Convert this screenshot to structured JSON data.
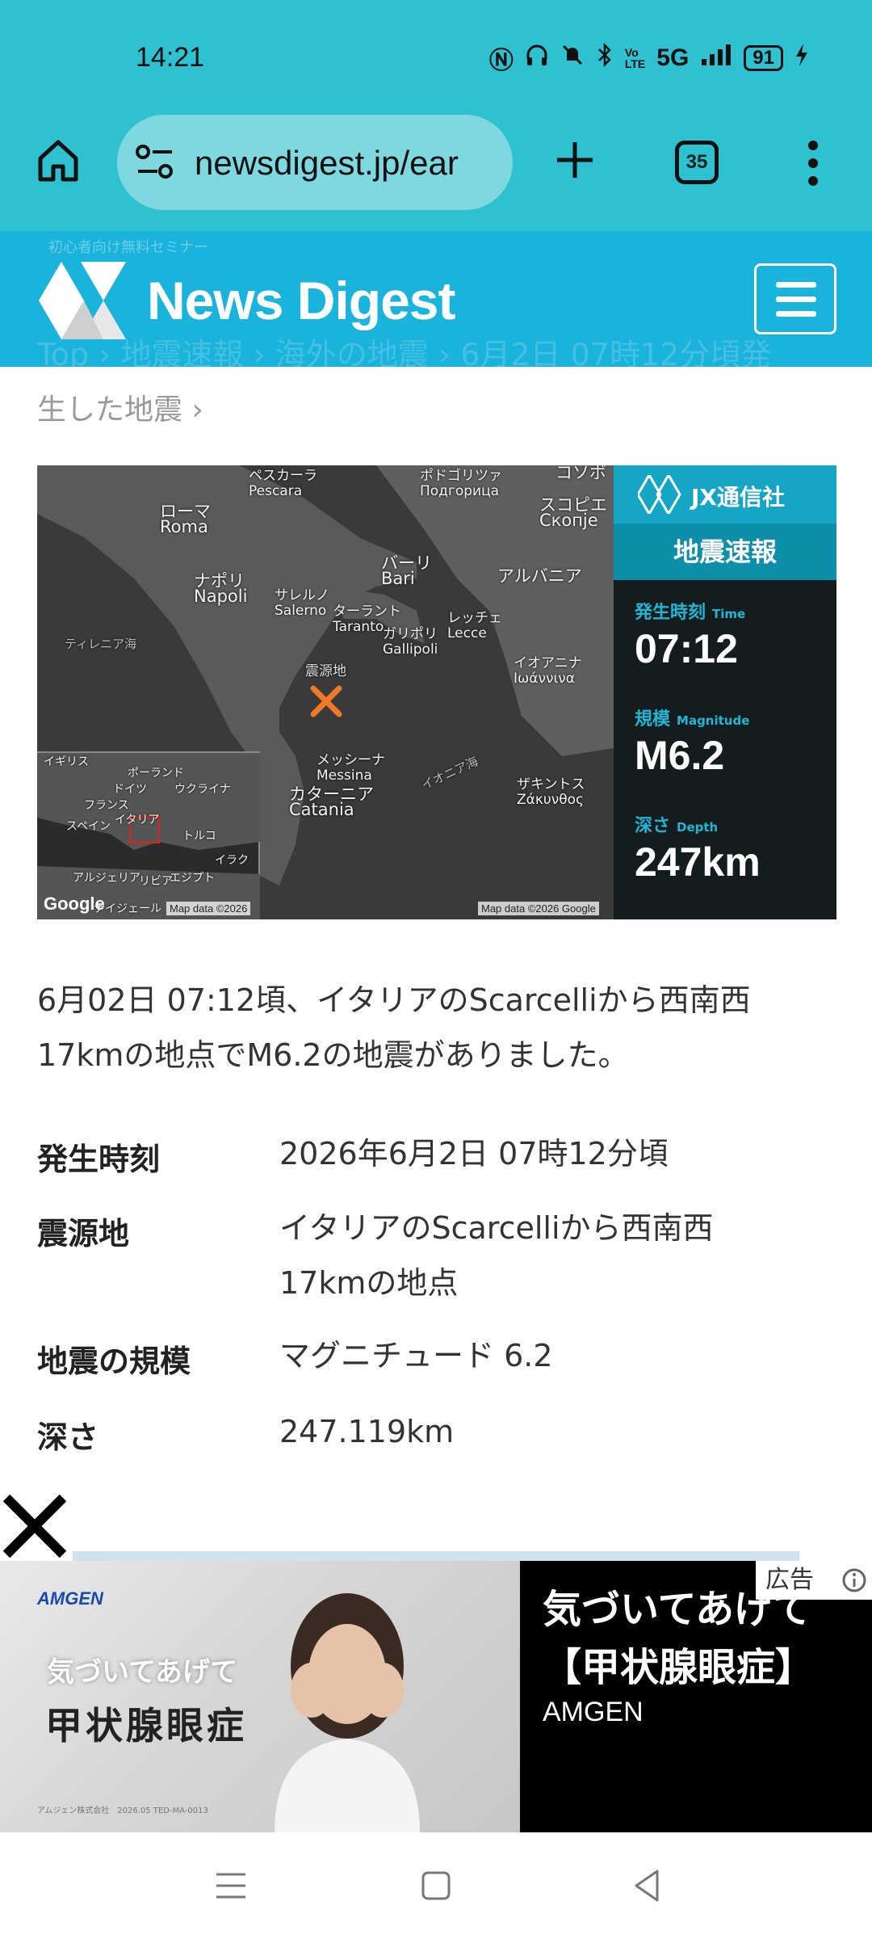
{
  "status_bar": {
    "time": "14:21",
    "network": "5G",
    "battery": "91",
    "icons": [
      "nfc-icon",
      "headphones-icon",
      "mute-icon",
      "bluetooth-icon",
      "volte-icon",
      "signal-icon",
      "battery-icon",
      "charging-icon"
    ]
  },
  "browser": {
    "url": "newsdigest.jp/ear",
    "tab_count": "35"
  },
  "site": {
    "logo_text": "News Digest",
    "promo_ghost": "初心者向け無料セミナー",
    "breadcrumb_ghost": "Top › 地震速報 › 海外の地震 › 6月2日 07時12分頃発",
    "breadcrumb_tail": "生した地震 ›"
  },
  "map": {
    "labels": [
      {
        "id": "pescara",
        "text": "ペスカーラ\nPescara"
      },
      {
        "id": "podgorica",
        "text": "ポドゴリツァ\nПодгорица"
      },
      {
        "id": "kosovo",
        "text": "コソボ"
      },
      {
        "id": "roma",
        "text": "ローマ\nRoma"
      },
      {
        "id": "skopje",
        "text": "スコピエ\nСкопје"
      },
      {
        "id": "bari",
        "text": "バーリ\nBari"
      },
      {
        "id": "albania",
        "text": "アルバニア"
      },
      {
        "id": "napoli",
        "text": "ナポリ\nNapoli"
      },
      {
        "id": "salerno",
        "text": "サレルノ\nSalerno"
      },
      {
        "id": "taranto",
        "text": "ターラント\nTaranto"
      },
      {
        "id": "lecce",
        "text": "レッチェ\nLecce"
      },
      {
        "id": "gallipoli",
        "text": "ガリポリ\nGallipoli"
      },
      {
        "id": "tyrrhenian",
        "text": "ティレニア海"
      },
      {
        "id": "epicenter",
        "text": "震源地"
      },
      {
        "id": "ioannina",
        "text": "イオアニナ\nΙωάννινα"
      },
      {
        "id": "messina",
        "text": "メッシーナ\nMessina"
      },
      {
        "id": "ionian",
        "text": "イオニア海"
      },
      {
        "id": "catania",
        "text": "カターニア\nCatania"
      },
      {
        "id": "zakynthos",
        "text": "ザキントス\nΖάκυνθος"
      }
    ],
    "inset_labels": [
      {
        "id": "uk",
        "text": "イギリス"
      },
      {
        "id": "poland",
        "text": "ポーランド"
      },
      {
        "id": "germany",
        "text": "ドイツ"
      },
      {
        "id": "ukraine",
        "text": "ウクライナ"
      },
      {
        "id": "france",
        "text": "フランス"
      },
      {
        "id": "italy",
        "text": "イタリア"
      },
      {
        "id": "spain",
        "text": "スペイン"
      },
      {
        "id": "turkey",
        "text": "トルコ"
      },
      {
        "id": "iraq",
        "text": "イラク"
      },
      {
        "id": "algeria",
        "text": "アルジェリア"
      },
      {
        "id": "libya",
        "text": "リビア"
      },
      {
        "id": "egypt",
        "text": "エジプト"
      },
      {
        "id": "nigeria",
        "text": "ナイジェール"
      }
    ],
    "google": "Google",
    "credit_inset": "Map data ©2026",
    "credit_main": "Map data ©2026 Google"
  },
  "quake_panel": {
    "brand": "JX通信社",
    "title": "地震速報",
    "time_label": "発生時刻",
    "time_label_en": "Time",
    "time_value": "07:12",
    "mag_label": "規模",
    "mag_label_en": "Magnitude",
    "mag_value": "M6.2",
    "depth_label": "深さ",
    "depth_label_en": "Depth",
    "depth_value": "247km",
    "accent_color": "#1fb6d6"
  },
  "article": {
    "lead": "6月02日 07:12頃、イタリアのScarcelliから西南西17kmの地点でM6.2の地震がありました。",
    "rows": [
      {
        "key": "発生時刻",
        "value": "2026年6月2日 07時12分頃"
      },
      {
        "key": "震源地",
        "value": "イタリアのScarcelliから西南西17kmの地点"
      },
      {
        "key": "地震の規模",
        "value": "マグニチュード 6.2"
      },
      {
        "key": "深さ",
        "value": "247.119km"
      }
    ]
  },
  "ad": {
    "logo": "AMGEN",
    "photo_line1": "気づいてあげて",
    "photo_line2": "甲状腺眼症",
    "fine_print": "アムジェン株式会社　2026.05 TED-MA-0013",
    "title": "気づいてあげて【甲状腺眼症】",
    "brand": "AMGEN",
    "choice_label": "広告"
  }
}
